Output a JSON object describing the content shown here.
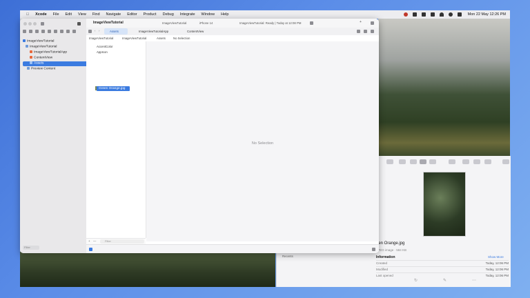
{
  "menubar": {
    "app": "Xcode",
    "items": [
      "File",
      "Edit",
      "View",
      "Find",
      "Navigate",
      "Editor",
      "Product",
      "Debug",
      "Integrate",
      "Window",
      "Help"
    ],
    "clock": "Mon 22 May  12:26 PM"
  },
  "xcode": {
    "project_title": "ImageViewTutorial",
    "scheme": "ImageViewTutorial",
    "destination": "iPhone 14",
    "status": "ImageViewTutorial: Ready | Today at 12:08 PM",
    "tabs": [
      {
        "label": "Assets"
      },
      {
        "label": "ImageViewTutorialApp"
      },
      {
        "label": "ContentView"
      }
    ],
    "jumpbar": [
      "ImageViewTutorial",
      "ImageViewTutorial",
      "Assets",
      "No Selection"
    ],
    "navigator": [
      {
        "label": "ImageViewTutorial"
      },
      {
        "label": "ImageViewTutorial"
      },
      {
        "label": "ImageViewTutorialApp"
      },
      {
        "label": "ContentView"
      },
      {
        "label": "Assets"
      },
      {
        "label": "Preview Content"
      }
    ],
    "filter_placeholder": "Filter",
    "assets": [
      "AccentColor",
      "AppIcon"
    ],
    "dragged_asset": "Green Orange.jpg",
    "editor_empty": "No Selection"
  },
  "preview": {
    "filename": "een Orange.jpg",
    "subtitle": "JPEG image · 584 KB",
    "info_heading": "Information",
    "show_more": "Show More",
    "rows": [
      {
        "key": "Created",
        "value": "Today, 12:06 PM"
      },
      {
        "key": "Modified",
        "value": "Today, 12:06 PM"
      },
      {
        "key": "Last opened",
        "value": "Today, 12:06 PM"
      }
    ],
    "sidebar_item": "Recents"
  }
}
